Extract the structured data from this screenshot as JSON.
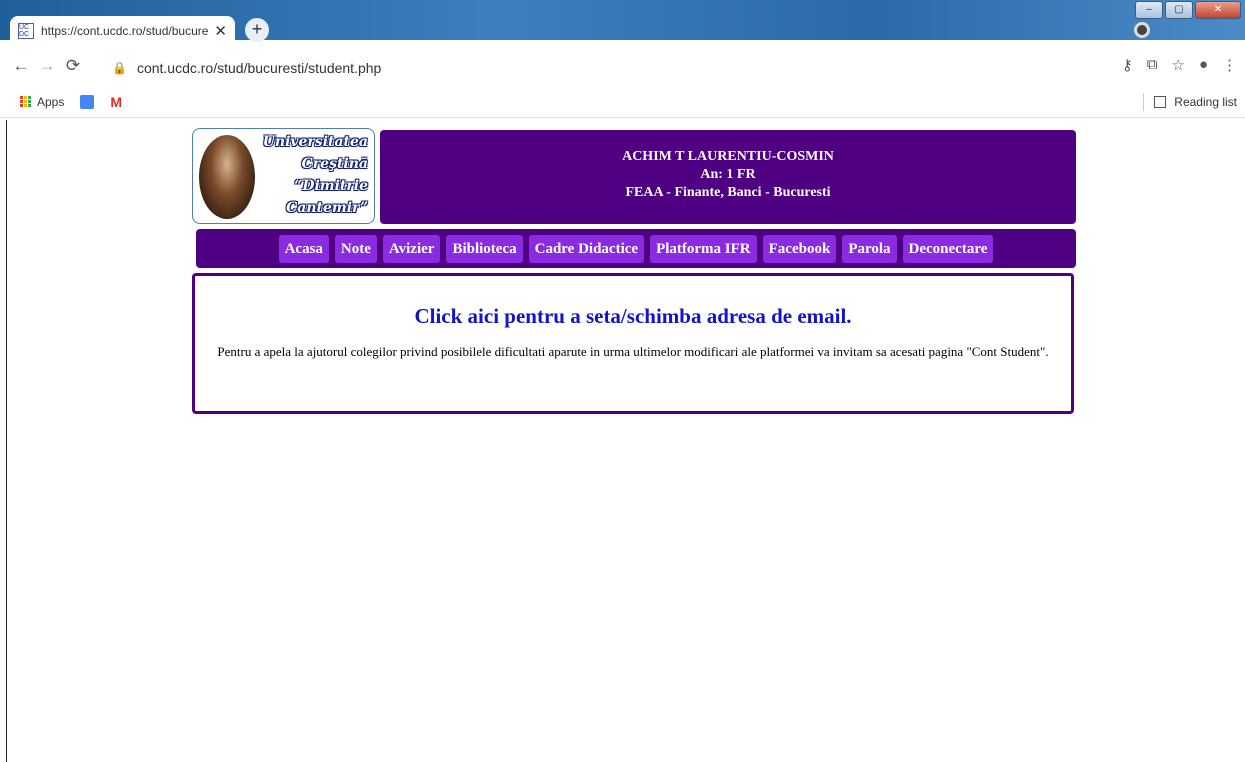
{
  "browser": {
    "tab_title": "https://cont.ucdc.ro/stud/bucure",
    "tab_close": "✕",
    "new_tab": "+",
    "favicon_text": "UC DC",
    "window_controls": {
      "minimize": "–",
      "maximize": "▢",
      "close": "✕"
    },
    "address": "cont.ucdc.ro/stud/bucuresti/student.php",
    "bookmarks": {
      "apps": "Apps",
      "gmail": "M",
      "reading_list": "Reading list"
    }
  },
  "logo": {
    "lines": [
      "Universitatea",
      "Creştină",
      "“Dimitrie",
      "Cantemir”"
    ]
  },
  "student": {
    "name": "ACHIM T LAURENTIU-COSMIN",
    "year": "An: 1 FR",
    "faculty": "FEAA - Finante, Banci - Bucuresti"
  },
  "nav": [
    "Acasa",
    "Note",
    "Avizier",
    "Biblioteca",
    "Cadre Didactice",
    "Platforma IFR",
    "Facebook",
    "Parola",
    "Deconectare"
  ],
  "content": {
    "email_link": "Click aici pentru a seta/schimba adresa de email.",
    "help_text": "Pentru a apela la ajutorul colegilor privind posibilele dificultati aparute in urma ultimelor modificari ale platformei va invitam sa acesati pagina \"Cont Student\"."
  },
  "colors": {
    "purple": "#4f0082",
    "nav_button": "#8a2be2",
    "link": "#1313c8"
  }
}
